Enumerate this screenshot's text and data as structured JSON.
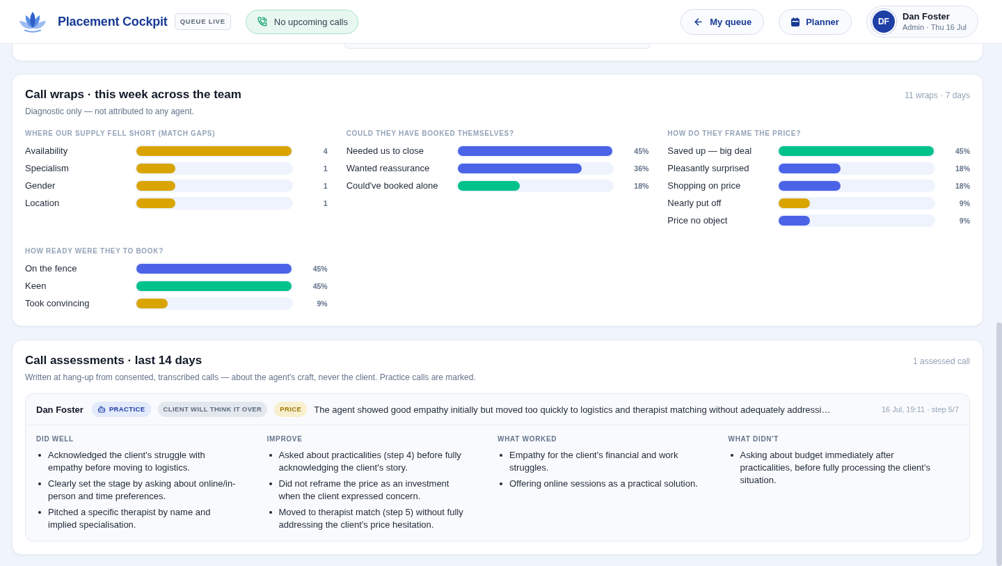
{
  "header": {
    "app_name": "Placement Cockpit",
    "status_badge": "QUEUE LIVE",
    "calls_status": "No upcoming calls",
    "buttons": [
      {
        "label": "My queue",
        "kind": "back"
      },
      {
        "label": "Planner",
        "kind": "calendar"
      }
    ],
    "user": {
      "initials": "DF",
      "name": "Dan Foster",
      "meta": "Admin · Thu 16 Jul"
    }
  },
  "call_wraps": {
    "title": "Call wraps · this week across the team",
    "subtitle": "Diagnostic only — not attributed to any agent.",
    "summary": "11 wraps · 7 days",
    "sections": [
      {
        "heading": "WHERE OUR SUPPLY FELL SHORT (MATCH GAPS)",
        "rows": [
          {
            "label": "Availability",
            "level": 1,
            "reading": "4",
            "color": "#d9a400"
          },
          {
            "label": "Specialism",
            "level": 0.25,
            "reading": "1",
            "color": "#d9a400"
          },
          {
            "label": "Gender",
            "level": 0.25,
            "reading": "1",
            "color": "#d9a400"
          },
          {
            "label": "Location",
            "level": 0.25,
            "reading": "1",
            "color": "#d9a400"
          }
        ]
      },
      {
        "heading": "COULD THEY HAVE BOOKED THEMSELVES?",
        "rows": [
          {
            "label": "Needed us to close",
            "level": 1,
            "reading": "45%",
            "color": "#4b63e6"
          },
          {
            "label": "Wanted reassurance",
            "level": 0.8,
            "reading": "36%",
            "color": "#4b63e6"
          },
          {
            "label": "Could've booked alone",
            "level": 0.4,
            "reading": "18%",
            "color": "#00c28a"
          }
        ]
      },
      {
        "heading": "HOW DO THEY FRAME THE PRICE?",
        "rows": [
          {
            "label": "Saved up — big deal",
            "level": 1,
            "reading": "45%",
            "color": "#00c28a"
          },
          {
            "label": "Pleasantly surprised",
            "level": 0.4,
            "reading": "18%",
            "color": "#4b63e6"
          },
          {
            "label": "Shopping on price",
            "level": 0.4,
            "reading": "18%",
            "color": "#4b63e6"
          },
          {
            "label": "Nearly put off",
            "level": 0.2,
            "reading": "9%",
            "color": "#d9a400"
          },
          {
            "label": "Price no object",
            "level": 0.2,
            "reading": "9%",
            "color": "#4b63e6"
          }
        ]
      },
      {
        "heading": "HOW READY WERE THEY TO BOOK?",
        "rows": [
          {
            "label": "On the fence",
            "level": 1,
            "reading": "45%",
            "color": "#4b63e6"
          },
          {
            "label": "Keen",
            "level": 1,
            "reading": "45%",
            "color": "#00c28a"
          },
          {
            "label": "Took convincing",
            "level": 0.2,
            "reading": "9%",
            "color": "#d9a400"
          }
        ]
      }
    ]
  },
  "call_assessments": {
    "title": "Call assessments · last 14 days",
    "subtitle": "Written at hang-up from consented, transcribed calls — about the agent's craft, never the client. Practice calls are marked.",
    "summary": "1 assessed call",
    "assessments": [
      {
        "agent": "Dan Foster",
        "tags": [
          {
            "label": "PRACTICE",
            "kind": "practice"
          },
          {
            "label": "CLIENT WILL THINK IT OVER",
            "kind": "outcome"
          },
          {
            "label": "PRICE",
            "kind": "objection"
          }
        ],
        "summary": "The agent showed good empathy initially but moved too quickly to logistics and therapist matching without adequately addressi…",
        "meta": "16 Jul, 19:11 · step 5/7",
        "columns": [
          {
            "heading": "DID WELL",
            "items": [
              "Acknowledged the client's struggle with empathy before moving to logistics.",
              "Clearly set the stage by asking about online/in-person and time preferences.",
              "Pitched a specific therapist by name and implied specialisation."
            ]
          },
          {
            "heading": "IMPROVE",
            "items": [
              "Asked about practicalities (step 4) before fully acknowledging the client's story.",
              "Did not reframe the price as an investment when the client expressed concern.",
              "Moved to therapist match (step 5) without fully addressing the client's price hesitation."
            ]
          },
          {
            "heading": "WHAT WORKED",
            "items": [
              "Empathy for the client's financial and work struggles.",
              "Offering online sessions as a practical solution."
            ]
          },
          {
            "heading": "WHAT DIDN'T",
            "items": [
              "Asking about budget immediately after practicalities, before fully processing the client's situation."
            ]
          }
        ]
      }
    ]
  }
}
